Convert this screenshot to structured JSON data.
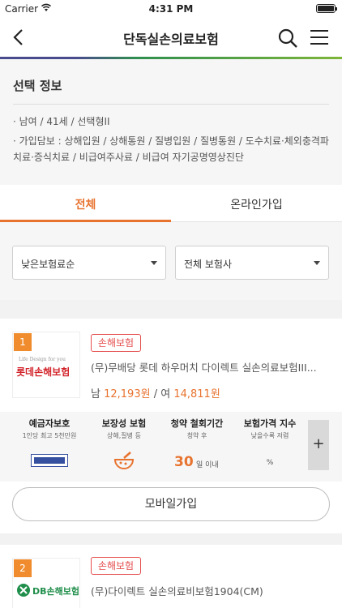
{
  "status_bar": {
    "carrier": "Carrier",
    "time": "4:31 PM"
  },
  "nav": {
    "title": "단독실손의료보험"
  },
  "selection": {
    "heading": "선택 정보",
    "basic_info": "· 남여 / 41세 / 선택형II",
    "coverage": "· 가입담보 : 상해입원 / 상해통원 / 질병입원 / 질병통원 / 도수치료·체외충격파치료·증식치료 / 비급여주사료 / 비급여 자기공명영상진단"
  },
  "tabs": [
    {
      "label": "전체",
      "active": true
    },
    {
      "label": "온라인가입",
      "active": false
    }
  ],
  "filters": {
    "sort": "낮은보험료순",
    "company": "전체 보험사"
  },
  "products": [
    {
      "rank": "1",
      "logo_text": "롯데손해보험",
      "logo_tagline": "Life Design for you",
      "category": "손해보험",
      "name": "(무)무배당 롯데 하우머치 다이렉트 실손의료보험III...",
      "price_male_label": "남",
      "price_male": "12,193원",
      "price_separator": "/",
      "price_female_label": "여",
      "price_female": "14,811원",
      "features": [
        {
          "title": "예금자보호",
          "sub": "1인당 최고 5천만원"
        },
        {
          "title": "보장성 보험",
          "sub": "상해,질병 등"
        },
        {
          "title": "청약 철회기간",
          "sub": "청약 후",
          "value": "30",
          "unit": "일 이내"
        },
        {
          "title": "보험가격 지수",
          "sub": "낮을수록 저렴",
          "value": "%"
        }
      ],
      "more_label": "+",
      "button_label": "모바일가입"
    },
    {
      "rank": "2",
      "logo_text": "DB손해보험",
      "category": "손해보험",
      "name": "(무)다이렉트 실손의료비보험1904(CM)"
    }
  ],
  "colors": {
    "accent": "#e8732f",
    "badge": "#e54d4d",
    "rank": "#f08c2d"
  }
}
